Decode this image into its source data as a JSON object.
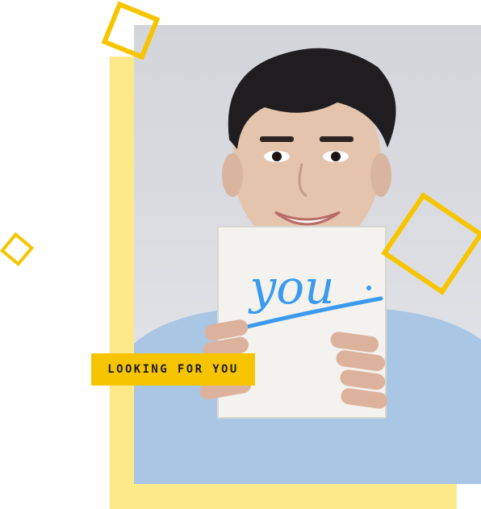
{
  "hero": {
    "tag_label": "LOOKING FOR YOU",
    "sign_text": "you",
    "accent_color": "#f7c500",
    "backdrop_color": "#fde98a",
    "sign_ink_color": "#3a9aee"
  }
}
